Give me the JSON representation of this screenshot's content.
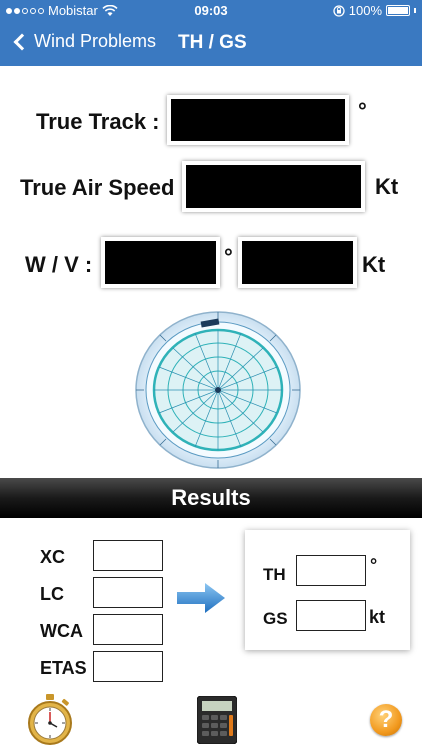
{
  "status_bar": {
    "carrier": "Mobistar",
    "time": "09:03",
    "battery": "100%"
  },
  "nav": {
    "back_label": "Wind Problems",
    "title": "TH / GS"
  },
  "inputs": {
    "true_track_label": "True Track :",
    "true_track_unit": "°",
    "tas_label": "True Air Speed :",
    "tas_unit": "Kt",
    "wv_label": "W / V :",
    "wv_dir_unit": "°",
    "wv_speed_unit": "Kt"
  },
  "results": {
    "header": "Results",
    "xc_label": "XC",
    "lc_label": "LC",
    "wca_label": "WCA",
    "etas_label": "ETAS",
    "th_label": "TH",
    "th_unit": "°",
    "gs_label": "GS",
    "gs_unit": "kt"
  },
  "toolbar": {
    "stopwatch_icon": "stopwatch-icon",
    "calculator_icon": "calculator-icon",
    "help_icon": "help-icon",
    "help_glyph": "?"
  },
  "colors": {
    "nav_blue": "#3a79c1",
    "arrow_blue": "#2f86d6",
    "help_orange": "#f29a1f"
  }
}
